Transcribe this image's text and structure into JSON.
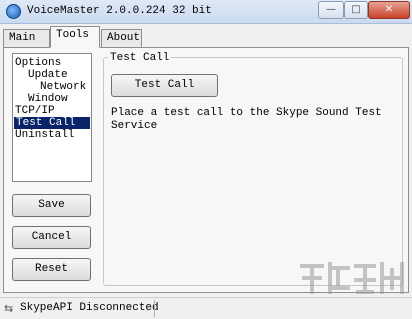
{
  "window": {
    "title": "VoiceMaster 2.0.0.224 32 bit",
    "controls": {
      "minimize": "—",
      "maximize": "□",
      "close": "✕"
    }
  },
  "tabs": [
    {
      "label": "Main"
    },
    {
      "label": "Tools"
    },
    {
      "label": "About"
    }
  ],
  "tree": {
    "items": [
      "Options",
      "Update",
      "Network",
      "Window",
      "TCP/IP",
      "Test Call",
      "Uninstall"
    ],
    "selected": "Test Call"
  },
  "buttons": {
    "save": "Save",
    "cancel": "Cancel",
    "reset": "Reset"
  },
  "panel": {
    "group_title": "Test Call",
    "test_button": "Test Call",
    "description": "Place a test call to the Skype Sound Test Service"
  },
  "status": {
    "text": "SkypeAPI Disconnected",
    "icon": "arrows-icon"
  },
  "colors": {
    "selection": "#0a246a",
    "close_button": "#c7432b"
  }
}
